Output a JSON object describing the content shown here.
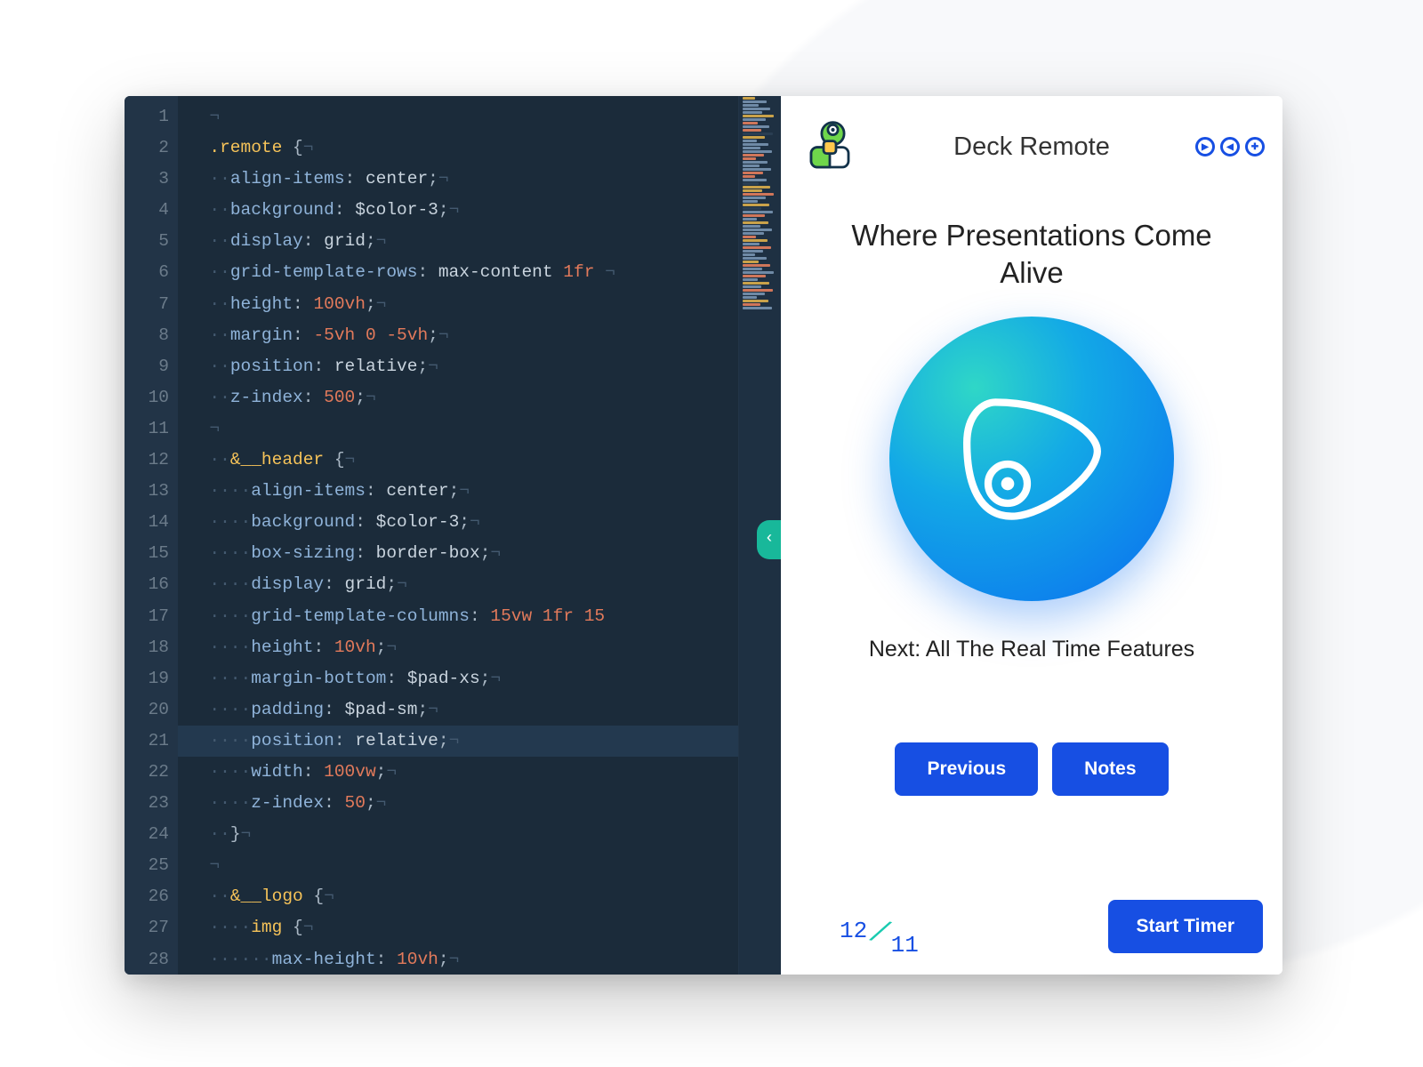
{
  "editor": {
    "line_numbers": [
      "1",
      "2",
      "3",
      "4",
      "5",
      "6",
      "7",
      "8",
      "9",
      "10",
      "11",
      "12",
      "13",
      "14",
      "15",
      "16",
      "17",
      "18",
      "19",
      "20",
      "21",
      "22",
      "23",
      "24",
      "25",
      "26",
      "27",
      "28"
    ],
    "highlighted_line_index": 20,
    "lines": [
      {
        "ws": "  ",
        "tokens": [
          {
            "t": "nl",
            "v": "¬"
          }
        ]
      },
      {
        "ws": "  ",
        "tokens": [
          {
            "t": "sel",
            "v": ".remote"
          },
          {
            "t": "punc",
            "v": " {"
          },
          {
            "t": "nl",
            "v": "¬"
          }
        ]
      },
      {
        "ws": "  ··",
        "tokens": [
          {
            "t": "prop",
            "v": "align-items"
          },
          {
            "t": "punc",
            "v": ": "
          },
          {
            "t": "val",
            "v": "center"
          },
          {
            "t": "punc",
            "v": ";"
          },
          {
            "t": "nl",
            "v": "¬"
          }
        ]
      },
      {
        "ws": "  ··",
        "tokens": [
          {
            "t": "prop",
            "v": "background"
          },
          {
            "t": "punc",
            "v": ": "
          },
          {
            "t": "var",
            "v": "$color-3"
          },
          {
            "t": "punc",
            "v": ";"
          },
          {
            "t": "nl",
            "v": "¬"
          }
        ]
      },
      {
        "ws": "  ··",
        "tokens": [
          {
            "t": "prop",
            "v": "display"
          },
          {
            "t": "punc",
            "v": ": "
          },
          {
            "t": "val",
            "v": "grid"
          },
          {
            "t": "punc",
            "v": ";"
          },
          {
            "t": "nl",
            "v": "¬"
          }
        ]
      },
      {
        "ws": "  ··",
        "tokens": [
          {
            "t": "prop",
            "v": "grid-template-rows"
          },
          {
            "t": "punc",
            "v": ": "
          },
          {
            "t": "val",
            "v": "max-content "
          },
          {
            "t": "num",
            "v": "1fr"
          },
          {
            "t": "nl",
            "v": " ¬"
          }
        ]
      },
      {
        "ws": "  ··",
        "tokens": [
          {
            "t": "prop",
            "v": "height"
          },
          {
            "t": "punc",
            "v": ": "
          },
          {
            "t": "num",
            "v": "100vh"
          },
          {
            "t": "punc",
            "v": ";"
          },
          {
            "t": "nl",
            "v": "¬"
          }
        ]
      },
      {
        "ws": "  ··",
        "tokens": [
          {
            "t": "prop",
            "v": "margin"
          },
          {
            "t": "punc",
            "v": ": "
          },
          {
            "t": "num",
            "v": "-5vh 0 -5vh"
          },
          {
            "t": "punc",
            "v": ";"
          },
          {
            "t": "nl",
            "v": "¬"
          }
        ]
      },
      {
        "ws": "  ··",
        "tokens": [
          {
            "t": "prop",
            "v": "position"
          },
          {
            "t": "punc",
            "v": ": "
          },
          {
            "t": "val",
            "v": "relative"
          },
          {
            "t": "punc",
            "v": ";"
          },
          {
            "t": "nl",
            "v": "¬"
          }
        ]
      },
      {
        "ws": "  ··",
        "tokens": [
          {
            "t": "prop",
            "v": "z-index"
          },
          {
            "t": "punc",
            "v": ": "
          },
          {
            "t": "num",
            "v": "500"
          },
          {
            "t": "punc",
            "v": ";"
          },
          {
            "t": "nl",
            "v": "¬"
          }
        ]
      },
      {
        "ws": "  ",
        "tokens": [
          {
            "t": "nl",
            "v": "¬"
          }
        ]
      },
      {
        "ws": "  ··",
        "tokens": [
          {
            "t": "sel",
            "v": "&__header"
          },
          {
            "t": "punc",
            "v": " {"
          },
          {
            "t": "nl",
            "v": "¬"
          }
        ]
      },
      {
        "ws": "  ····",
        "tokens": [
          {
            "t": "prop",
            "v": "align-items"
          },
          {
            "t": "punc",
            "v": ": "
          },
          {
            "t": "val",
            "v": "center"
          },
          {
            "t": "punc",
            "v": ";"
          },
          {
            "t": "nl",
            "v": "¬"
          }
        ]
      },
      {
        "ws": "  ····",
        "tokens": [
          {
            "t": "prop",
            "v": "background"
          },
          {
            "t": "punc",
            "v": ": "
          },
          {
            "t": "var",
            "v": "$color-3"
          },
          {
            "t": "punc",
            "v": ";"
          },
          {
            "t": "nl",
            "v": "¬"
          }
        ]
      },
      {
        "ws": "  ····",
        "tokens": [
          {
            "t": "prop",
            "v": "box-sizing"
          },
          {
            "t": "punc",
            "v": ": "
          },
          {
            "t": "val",
            "v": "border-box"
          },
          {
            "t": "punc",
            "v": ";"
          },
          {
            "t": "nl",
            "v": "¬"
          }
        ]
      },
      {
        "ws": "  ····",
        "tokens": [
          {
            "t": "prop",
            "v": "display"
          },
          {
            "t": "punc",
            "v": ": "
          },
          {
            "t": "val",
            "v": "grid"
          },
          {
            "t": "punc",
            "v": ";"
          },
          {
            "t": "nl",
            "v": "¬"
          }
        ]
      },
      {
        "ws": "  ····",
        "tokens": [
          {
            "t": "prop",
            "v": "grid-template-columns"
          },
          {
            "t": "punc",
            "v": ": "
          },
          {
            "t": "num",
            "v": "15vw 1fr 15"
          },
          {
            "t": "nl",
            "v": ""
          }
        ]
      },
      {
        "ws": "  ····",
        "tokens": [
          {
            "t": "prop",
            "v": "height"
          },
          {
            "t": "punc",
            "v": ": "
          },
          {
            "t": "num",
            "v": "10vh"
          },
          {
            "t": "punc",
            "v": ";"
          },
          {
            "t": "nl",
            "v": "¬"
          }
        ]
      },
      {
        "ws": "  ····",
        "tokens": [
          {
            "t": "prop",
            "v": "margin-bottom"
          },
          {
            "t": "punc",
            "v": ": "
          },
          {
            "t": "var",
            "v": "$pad-xs"
          },
          {
            "t": "punc",
            "v": ";"
          },
          {
            "t": "nl",
            "v": "¬"
          }
        ]
      },
      {
        "ws": "  ····",
        "tokens": [
          {
            "t": "prop",
            "v": "padding"
          },
          {
            "t": "punc",
            "v": ": "
          },
          {
            "t": "var",
            "v": "$pad-sm"
          },
          {
            "t": "punc",
            "v": ";"
          },
          {
            "t": "nl",
            "v": "¬"
          }
        ]
      },
      {
        "ws": "  ····",
        "tokens": [
          {
            "t": "prop",
            "v": "position"
          },
          {
            "t": "punc",
            "v": ": "
          },
          {
            "t": "val",
            "v": "relative"
          },
          {
            "t": "punc",
            "v": ";"
          },
          {
            "t": "nl",
            "v": "¬"
          }
        ]
      },
      {
        "ws": "  ····",
        "tokens": [
          {
            "t": "prop",
            "v": "width"
          },
          {
            "t": "punc",
            "v": ": "
          },
          {
            "t": "num",
            "v": "100vw"
          },
          {
            "t": "punc",
            "v": ";"
          },
          {
            "t": "nl",
            "v": "¬"
          }
        ]
      },
      {
        "ws": "  ····",
        "tokens": [
          {
            "t": "prop",
            "v": "z-index"
          },
          {
            "t": "punc",
            "v": ": "
          },
          {
            "t": "num",
            "v": "50"
          },
          {
            "t": "punc",
            "v": ";"
          },
          {
            "t": "nl",
            "v": "¬"
          }
        ]
      },
      {
        "ws": "  ··",
        "tokens": [
          {
            "t": "punc",
            "v": "}"
          },
          {
            "t": "nl",
            "v": "¬"
          }
        ]
      },
      {
        "ws": "  ",
        "tokens": [
          {
            "t": "nl",
            "v": "¬"
          }
        ]
      },
      {
        "ws": "  ··",
        "tokens": [
          {
            "t": "sel",
            "v": "&__logo"
          },
          {
            "t": "punc",
            "v": " {"
          },
          {
            "t": "nl",
            "v": "¬"
          }
        ]
      },
      {
        "ws": "  ····",
        "tokens": [
          {
            "t": "sel",
            "v": "img"
          },
          {
            "t": "punc",
            "v": " {"
          },
          {
            "t": "nl",
            "v": "¬"
          }
        ]
      },
      {
        "ws": "  ······",
        "tokens": [
          {
            "t": "prop",
            "v": "max-height"
          },
          {
            "t": "punc",
            "v": ": "
          },
          {
            "t": "num",
            "v": "10vh"
          },
          {
            "t": "punc",
            "v": ";"
          },
          {
            "t": "nl",
            "v": "¬"
          }
        ]
      }
    ],
    "minimap_colors": [
      "#c9a24a",
      "#6f8aa6",
      "#6f8aa6",
      "#6f8aa6",
      "#6f8aa6",
      "#c9a24a",
      "#6f8aa6",
      "#d0765a",
      "#6f8aa6",
      "#d0765a",
      "#2a3e52",
      "#c9a24a",
      "#6f8aa6",
      "#6f8aa6",
      "#6f8aa6",
      "#6f8aa6",
      "#d0765a",
      "#d0765a",
      "#6f8aa6",
      "#6f8aa6",
      "#6f8aa6",
      "#d0765a",
      "#d0765a",
      "#6f8aa6",
      "#2a3e52",
      "#c9a24a",
      "#c9a24a",
      "#d0765a",
      "#6f8aa6",
      "#6f8aa6",
      "#c9a24a",
      "#2a3e52",
      "#6f8aa6",
      "#d0765a",
      "#6f8aa6",
      "#c9a24a",
      "#6f8aa6",
      "#6f8aa6",
      "#6f8aa6",
      "#d0765a",
      "#c9a24a",
      "#6f8aa6",
      "#d0765a",
      "#6f8aa6",
      "#6f8aa6",
      "#6f8aa6",
      "#c9a24a",
      "#d0765a",
      "#6f8aa6",
      "#6f8aa6",
      "#d0765a",
      "#6f8aa6",
      "#c9a24a",
      "#6f8aa6",
      "#d0765a",
      "#6f8aa6",
      "#6f8aa6",
      "#c9a24a",
      "#d0765a",
      "#6f8aa6"
    ]
  },
  "collapse_glyph": "‹",
  "remote": {
    "title": "Deck Remote",
    "slide_title": "Where Presentations Come Alive",
    "next_label_prefix": "Next: ",
    "next_slide": "All The Real Time Features",
    "buttons": {
      "previous": "Previous",
      "notes": "Notes",
      "start_timer": "Start Timer"
    },
    "counter": {
      "current": "12",
      "total": "11"
    },
    "menu_icon_glyphs": [
      "▶",
      "◀",
      "✚"
    ]
  }
}
